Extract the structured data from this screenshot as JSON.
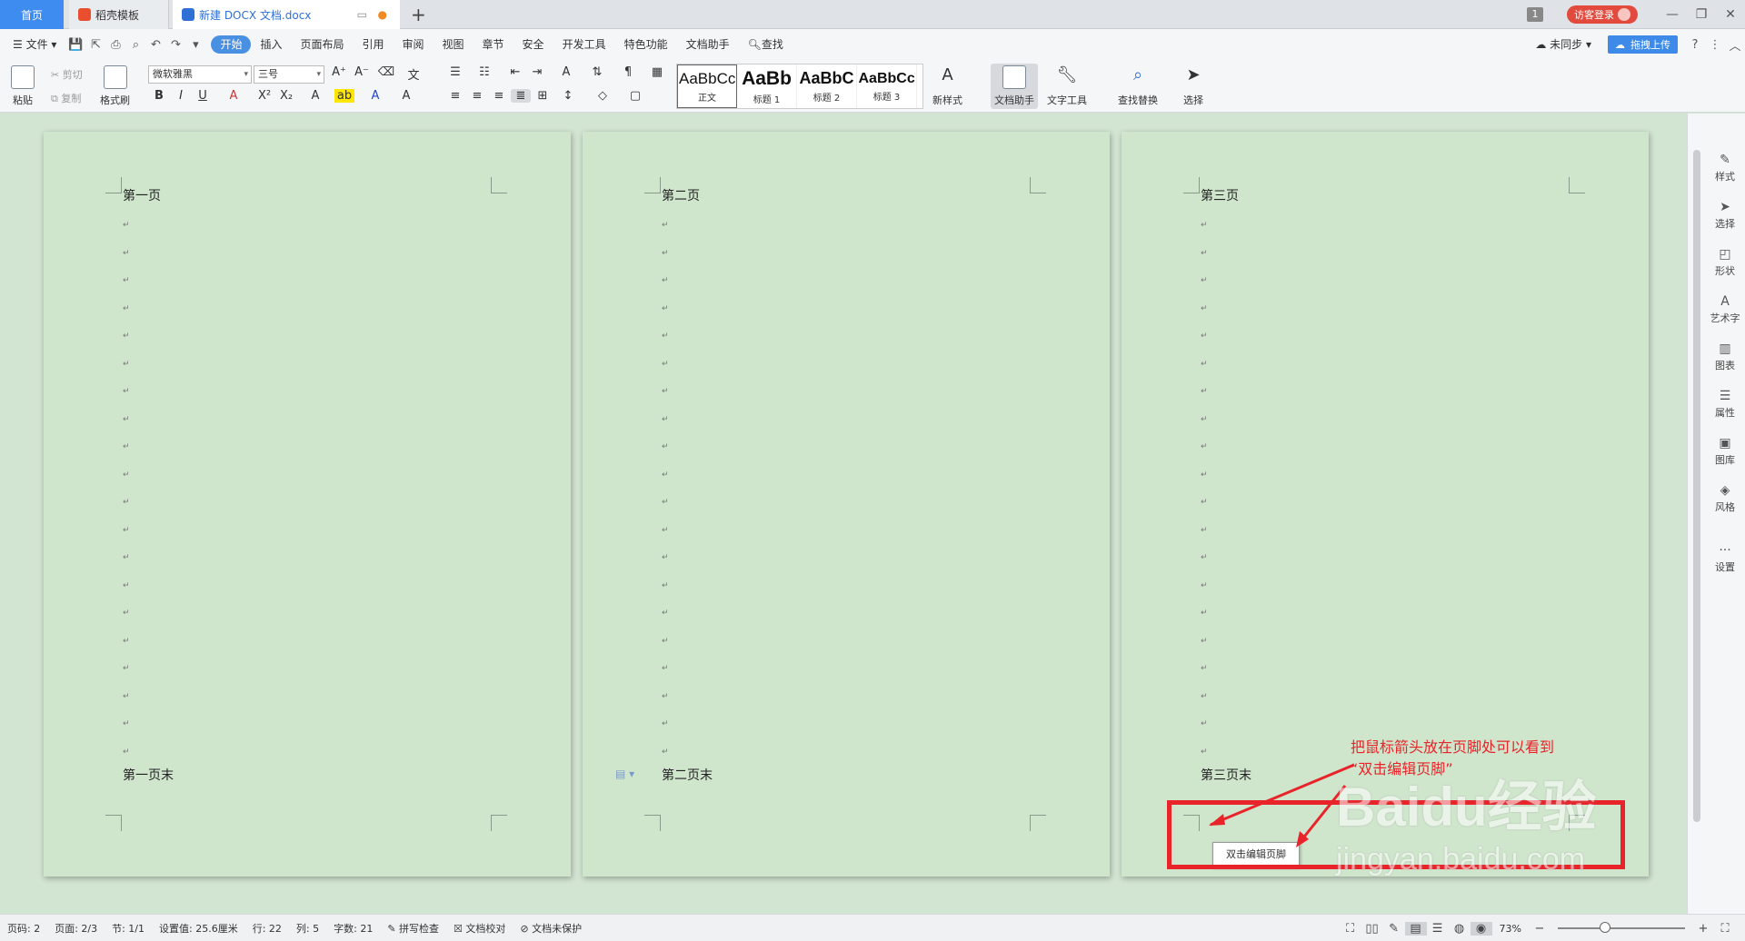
{
  "tabbar": {
    "home_label": "首页",
    "daoke_label": "稻壳模板",
    "doc_label": "新建 DOCX 文档.docx",
    "new_tab_symbol": "+",
    "badge_count": "1",
    "login_label": "访客登录"
  },
  "menu": {
    "file_label": "文件",
    "items": [
      "开始",
      "插入",
      "页面布局",
      "引用",
      "审阅",
      "视图",
      "章节",
      "安全",
      "开发工具",
      "特色功能",
      "文档助手"
    ],
    "search_label": "查找",
    "sync_label": "未同步",
    "upload_label": "拖拽上传"
  },
  "ribbon": {
    "paste_label": "粘贴",
    "cut_label": "剪切",
    "copy_label": "复制",
    "format_painter_label": "格式刷",
    "font_name": "微软雅黑",
    "font_size": "三号",
    "styles": [
      {
        "sample": "AaBbCcDd",
        "name": "正文"
      },
      {
        "sample": "AaBb",
        "name": "标题 1"
      },
      {
        "sample": "AaBbC",
        "name": "标题 2"
      },
      {
        "sample": "AaBbCcI",
        "name": "标题 3"
      }
    ],
    "new_style_label": "新样式",
    "doc_assistant_label": "文档助手",
    "text_tools_label": "文字工具",
    "find_replace_label": "查找替换",
    "select_label": "选择"
  },
  "pages": [
    {
      "header_text": "第一页",
      "footer_text": "第一页末"
    },
    {
      "header_text": "第二页",
      "footer_text": "第二页末"
    },
    {
      "header_text": "第三页",
      "footer_text": "第三页末"
    }
  ],
  "footer_tooltip": "双击编辑页脚",
  "annotation": {
    "line1": "把鼠标箭头放在页脚处可以看到",
    "line2": "“双击编辑页脚”"
  },
  "watermark": {
    "brand": "Baidu经验",
    "url": "jingyan.baidu.com"
  },
  "sidebar": [
    "样式",
    "选择",
    "形状",
    "艺术字",
    "图表",
    "属性",
    "图库",
    "风格",
    "设置"
  ],
  "status": {
    "page_num": "页码: 2",
    "pages": "页面: 2/3",
    "section": "节: 1/1",
    "setting": "设置值: 25.6厘米",
    "row": "行: 22",
    "col": "列: 5",
    "words": "字数: 21",
    "spell": "拼写检查",
    "proof": "文档校对",
    "protect": "文档未保护",
    "zoom": "73%"
  }
}
